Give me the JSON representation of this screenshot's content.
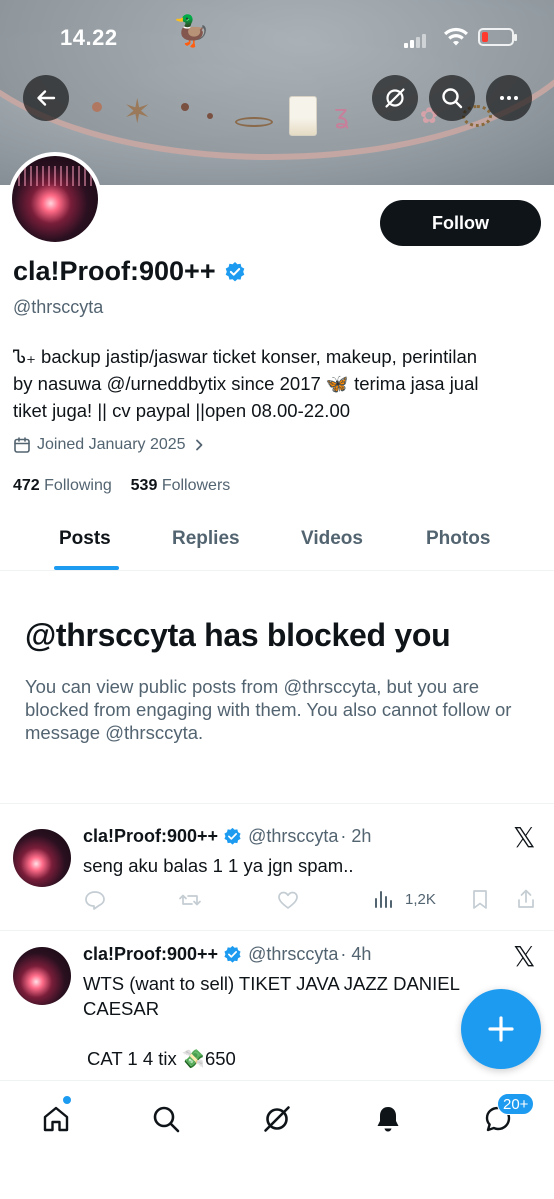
{
  "status_bar": {
    "time": "14.22"
  },
  "header": {
    "icons": [
      "back-arrow-icon",
      "grok-icon",
      "search-icon",
      "more-icon"
    ]
  },
  "profile": {
    "name": "cla!Proof:900++",
    "handle": "@thrsccyta",
    "bio_line1": "Ꮦ₊ backup jastip/jaswar ticket konser, makeup, perintilan",
    "bio_line2": "by nasuwa @/urneddbytix since 2017 🦋 terima jasa jual",
    "bio_line3": "tiket juga! || cv paypal ||open 08.00-22.00",
    "joined": "Joined January 2025",
    "following_count": "472",
    "following_label": "Following",
    "followers_count": "539",
    "followers_label": "Followers",
    "follow_button": "Follow"
  },
  "tabs": [
    "Posts",
    "Replies",
    "Videos",
    "Photos"
  ],
  "blocked": {
    "title": "@thrsccyta has blocked you",
    "message": "You can view public posts from @thrsccyta, but you are blocked from engaging with them. You also cannot follow or message @thrsccyta."
  },
  "posts": [
    {
      "name": "cla!Proof:900++",
      "handle": "@thrsccyta",
      "time": "· 2h",
      "text": "seng aku balas 1 1 ya jgn spam..",
      "views": "1,2K"
    },
    {
      "name": "cla!Proof:900++",
      "handle": "@thrsccyta",
      "time": "· 4h",
      "text_line1": "WTS (want to sell) TIKET JAVA JAZZ DANIEL",
      "text_line2": "CAESAR",
      "text_line3": "CAT 1 4 tix 💸650"
    }
  ],
  "bottom_nav": {
    "items": [
      "home-icon",
      "search-icon",
      "grok-icon",
      "notifications-icon",
      "messages-icon"
    ],
    "messages_badge": "20+"
  },
  "colors": {
    "accent": "#1d9bf0",
    "text": "#0f1419",
    "secondary": "#536471"
  }
}
